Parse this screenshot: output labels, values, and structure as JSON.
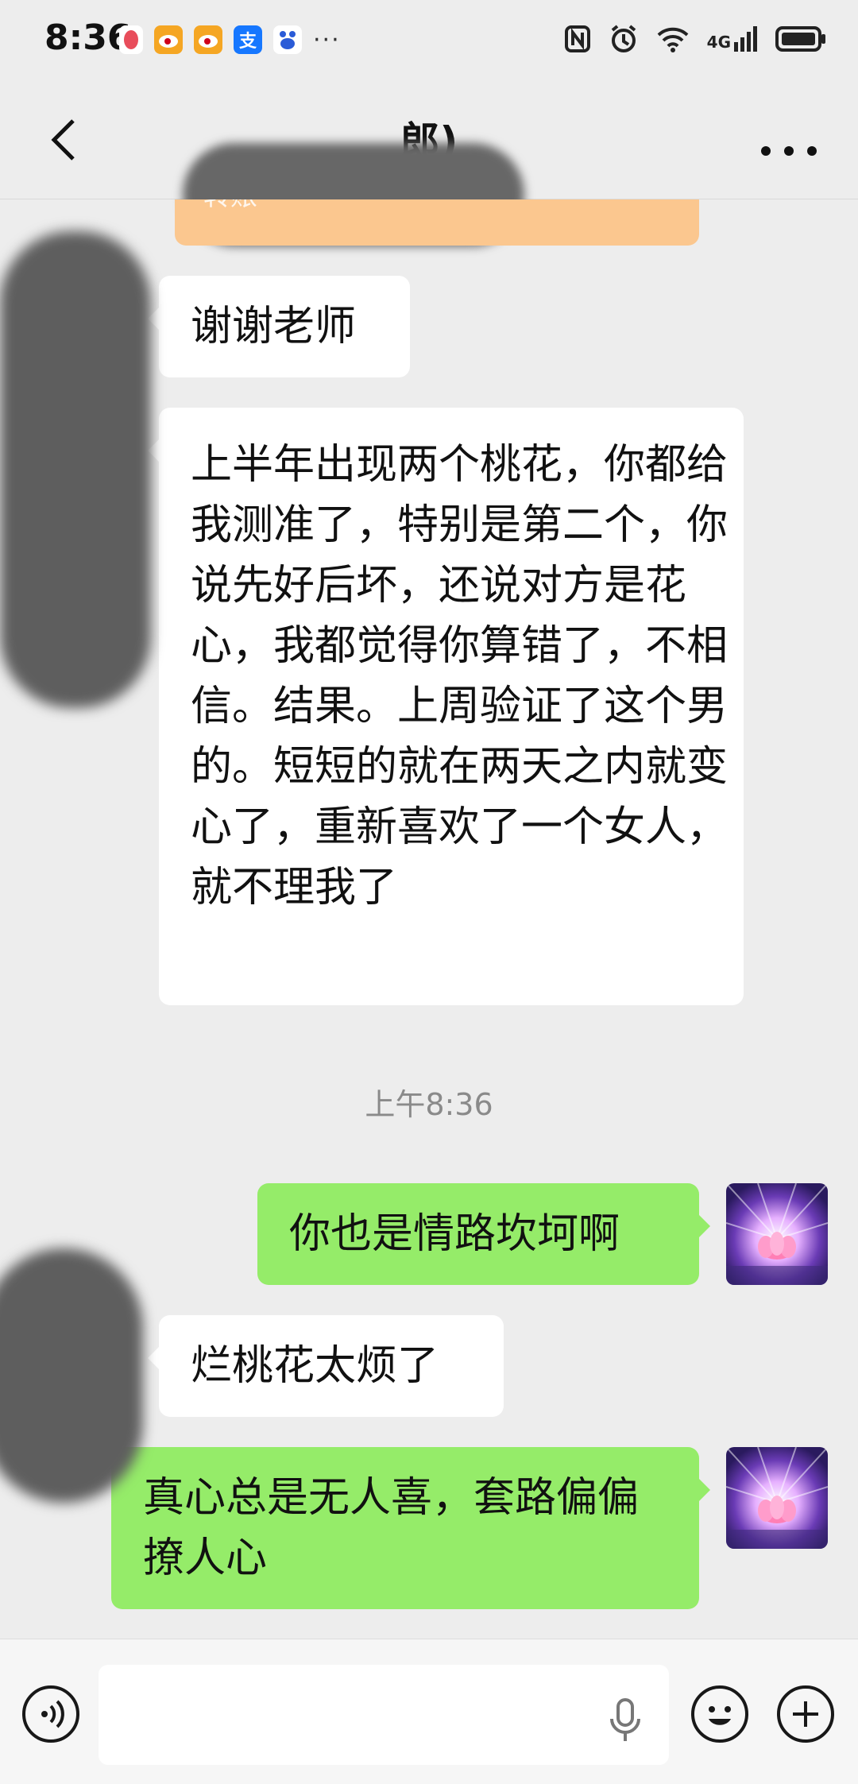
{
  "status_bar": {
    "time": "8:36",
    "more_notifications": "···",
    "network": "4G"
  },
  "header": {
    "title": "郎)"
  },
  "chat": {
    "transfer_label": "转账",
    "messages": [
      {
        "side": "in",
        "text": "谢谢老师"
      },
      {
        "side": "in",
        "text": "上半年出现两个桃花，你都给我测准了，特别是第二个，你说先好后坏，还说对方是花心，我都觉得你算错了，不相信。结果。上周验证了这个男的。短短的就在两天之内就变心了，重新喜欢了一个女人，就不理我了"
      },
      {
        "side": "time",
        "text": "上午8:36"
      },
      {
        "side": "out",
        "text": "你也是情路坎坷啊"
      },
      {
        "side": "in",
        "text": "烂桃花太烦了"
      },
      {
        "side": "out",
        "text": "真心总是无人喜，套路偏偏撩人心"
      }
    ]
  },
  "input_bar": {
    "placeholder": ""
  },
  "colors": {
    "background": "#ededed",
    "incoming_bubble": "#ffffff",
    "outgoing_bubble": "#95ec69",
    "transfer_card": "#fbc78f"
  }
}
